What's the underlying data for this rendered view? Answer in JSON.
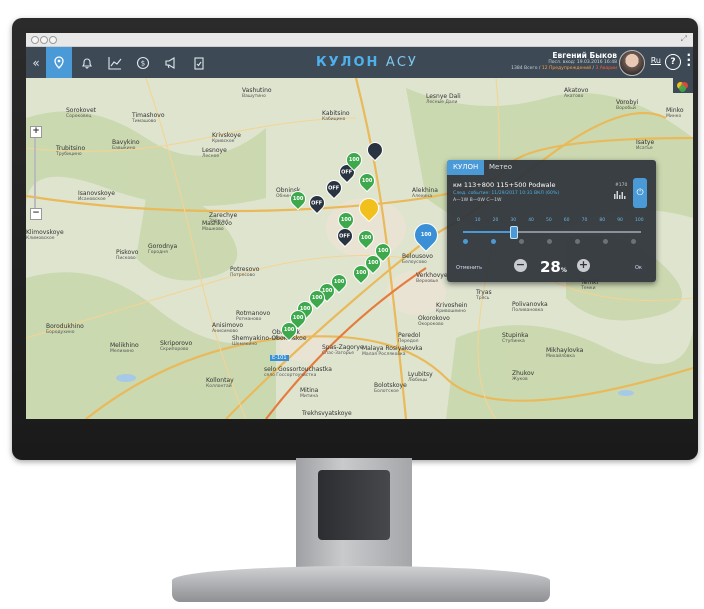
{
  "app": {
    "brand": "КУЛОН",
    "brand_suffix": "АСУ"
  },
  "user": {
    "name": "Евгений Быков",
    "last_login": "Посл. вход: 19.03.2016 16:48",
    "stats_prefix": "1384 Всего /",
    "warnings": "12 Предупреждений",
    "alarms": "3 Аварии",
    "lang": "Ru",
    "help": "?"
  },
  "toolbar": {
    "icons": [
      "collapse-icon",
      "map-pin-icon",
      "bell-icon",
      "chart-icon",
      "money-icon",
      "megaphone-icon",
      "clipboard-icon"
    ]
  },
  "colors": {
    "topbar": "#3d4a56",
    "accent": "#4b9ad8",
    "green_marker": "#3ea84c",
    "dark_marker": "#2a3440"
  },
  "map": {
    "places": [
      {
        "label": "Vashutino",
        "sub": "Вашутино"
      },
      {
        "label": "Sorokovet",
        "sub": "Сороковец"
      },
      {
        "label": "Timashovo",
        "sub": "Тимашово"
      },
      {
        "label": "Kabitsino",
        "sub": "Кабицино"
      },
      {
        "label": "Lesnye Dali",
        "sub": "Лесные Дали"
      },
      {
        "label": "Akatovo",
        "sub": "Акатово"
      },
      {
        "label": "Vorobyi",
        "sub": "Воробьи"
      },
      {
        "label": "Minko",
        "sub": "Минко"
      },
      {
        "label": "Krivskoye",
        "sub": "Кривское"
      },
      {
        "label": "Trubitsino",
        "sub": "Трубицино"
      },
      {
        "label": "Bavykino",
        "sub": "Бавыкино"
      },
      {
        "label": "Lesnoye",
        "sub": "Лесное"
      },
      {
        "label": "Isatye",
        "sub": "Исатье"
      },
      {
        "label": "Obninsk",
        "sub": "Обнинск"
      },
      {
        "label": "Isanovskoye",
        "sub": "Исановское"
      },
      {
        "label": "Mashkovo",
        "sub": "Машково"
      },
      {
        "label": "Zarechye",
        "sub": "Заречье"
      },
      {
        "label": "Alekhina",
        "sub": "Алехина"
      },
      {
        "label": "Klimovskoye",
        "sub": "Климовское"
      },
      {
        "label": "Piskovo",
        "sub": "Писково"
      },
      {
        "label": "Gorodnya",
        "sub": "Городня"
      },
      {
        "label": "Belousovo",
        "sub": "Белоусово"
      },
      {
        "label": "Potresovo",
        "sub": "Потресово"
      },
      {
        "label": "Verkhovye",
        "sub": "Верховье"
      },
      {
        "label": "Tryas",
        "sub": "Трясь"
      },
      {
        "label": "Temki",
        "sub": "Темки"
      },
      {
        "label": "Rotmanovo",
        "sub": "Ротманово"
      },
      {
        "label": "Krivoshein",
        "sub": "Кривошеино"
      },
      {
        "label": "Okorokovo",
        "sub": "Окороково"
      },
      {
        "label": "Polivanovka",
        "sub": "Поливановка"
      },
      {
        "label": "Borodukhino",
        "sub": "Бородухино"
      },
      {
        "label": "Anisimovo",
        "sub": "Анисимово"
      },
      {
        "label": "Shemyakino-Obolenskoe",
        "sub": "Шемякино"
      },
      {
        "label": "Obolensk",
        "sub": "Оболенск"
      },
      {
        "label": "Stupinka",
        "sub": "Ступинка"
      },
      {
        "label": "Melikhino",
        "sub": "Мелихино"
      },
      {
        "label": "Skriporovo",
        "sub": "Скрипорово"
      },
      {
        "label": "Peredol",
        "sub": "Передол"
      },
      {
        "label": "Spas-Zagorye",
        "sub": "Спас-Загорье"
      },
      {
        "label": "Malaya Rosiyakovka",
        "sub": "Малая Росляковка"
      },
      {
        "label": "Mikhaylovka",
        "sub": "Михайловка"
      },
      {
        "label": "Kollontay",
        "sub": "Коллонтай"
      },
      {
        "label": "selo Gossortouchastka",
        "sub": "село Госсортоучастка"
      },
      {
        "label": "Lyubitsy",
        "sub": "Любицы"
      },
      {
        "label": "Zhukov",
        "sub": "Жуков"
      },
      {
        "label": "Mitina",
        "sub": "Митина"
      },
      {
        "label": "Bolotskoye",
        "sub": "Болотское"
      },
      {
        "label": "Trekhsvyatskoye",
        "sub": ""
      }
    ],
    "markers": [
      {
        "kind": "green",
        "text": "100"
      },
      {
        "kind": "dark",
        "text": "OFF"
      },
      {
        "kind": "dark",
        "text": "OFF"
      },
      {
        "kind": "green",
        "text": "100"
      },
      {
        "kind": "dark",
        "text": "OFF"
      },
      {
        "kind": "green",
        "text": "100"
      },
      {
        "kind": "dark",
        "text": ""
      },
      {
        "kind": "yellow",
        "text": ""
      },
      {
        "kind": "green",
        "text": "100"
      },
      {
        "kind": "dark",
        "text": "OFF"
      },
      {
        "kind": "green",
        "text": "100"
      },
      {
        "kind": "blue",
        "text": "100"
      },
      {
        "kind": "green",
        "text": "100"
      },
      {
        "kind": "green",
        "text": "100"
      },
      {
        "kind": "green",
        "text": "100"
      },
      {
        "kind": "green",
        "text": "100"
      },
      {
        "kind": "green",
        "text": "100"
      },
      {
        "kind": "green",
        "text": "100"
      },
      {
        "kind": "green",
        "text": "100"
      },
      {
        "kind": "green",
        "text": "100"
      },
      {
        "kind": "green",
        "text": "100"
      }
    ],
    "road_badge": "E-101",
    "zoom_in": "+",
    "zoom_out": "−"
  },
  "panel": {
    "tabs": [
      "КУЛОН",
      "Метео"
    ],
    "title": "км 113+800 115+500 Podwale",
    "next_event": "След. событие: 11/29/2017 10:31 ВКЛ (60%)",
    "states": "A—1W B—0W C—1W",
    "id": "#170",
    "scale": [
      "0",
      "10",
      "20",
      "30",
      "40",
      "50",
      "60",
      "70",
      "80",
      "90",
      "100"
    ],
    "level_percent": 28,
    "percent_value": "28",
    "percent_unit": "%",
    "cancel": "Отменить",
    "ok": "Ок",
    "minus": "−",
    "plus": "+"
  }
}
